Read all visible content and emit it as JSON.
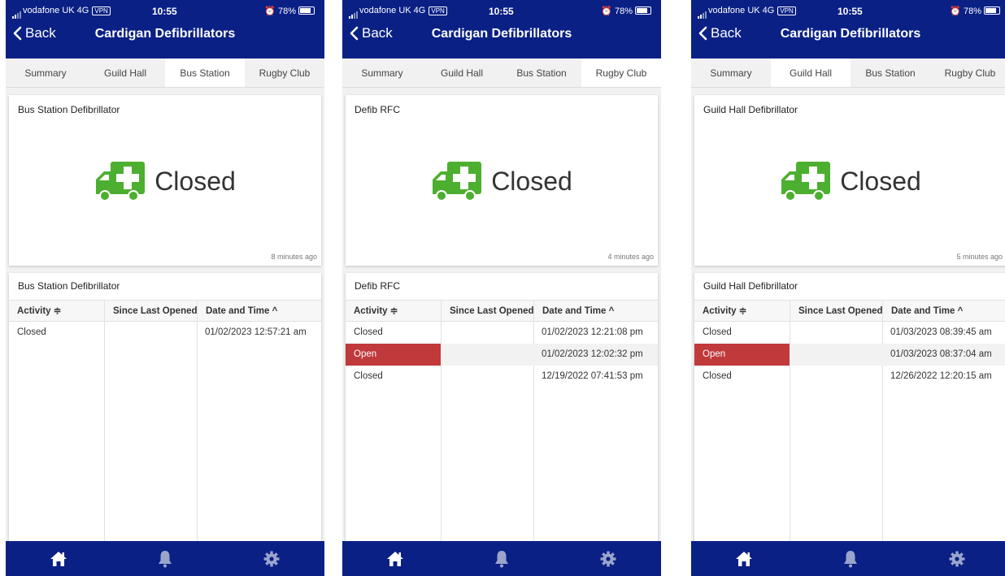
{
  "colors": {
    "header": "#0a2085",
    "ambulance": "#4caf2f",
    "open": "#c0393b"
  },
  "status_bar": {
    "carrier": "vodafone UK",
    "network": "4G",
    "vpn": "VPN",
    "time": "10:55",
    "battery": "78%"
  },
  "nav": {
    "back_label": "Back",
    "title": "Cardigan Defibrillators"
  },
  "tabs": [
    "Summary",
    "Guild Hall",
    "Bus Station",
    "Rugby Club"
  ],
  "table_headers": {
    "activity": "Activity ≑",
    "since": "Since Last Opened",
    "datetime": "Date and Time ^"
  },
  "footer_icons": [
    "home-icon",
    "bell-icon",
    "gear-icon"
  ],
  "screens": [
    {
      "active_tab": 2,
      "card_title": "Bus Station Defibrillator",
      "status": "Closed",
      "updated": "8 minutes ago",
      "table_title": "Bus Station Defibrillator",
      "rows": [
        {
          "activity": "Closed",
          "since": "",
          "datetime": "01/02/2023 12:57:21 am"
        }
      ]
    },
    {
      "active_tab": 3,
      "card_title": "Defib RFC",
      "status": "Closed",
      "updated": "4 minutes ago",
      "table_title": "Defib RFC",
      "rows": [
        {
          "activity": "Closed",
          "since": "",
          "datetime": "01/02/2023 12:21:08 pm"
        },
        {
          "activity": "Open",
          "since": "",
          "datetime": "01/02/2023 12:02:32 pm"
        },
        {
          "activity": "Closed",
          "since": "",
          "datetime": "12/19/2022 07:41:53 pm"
        }
      ]
    },
    {
      "active_tab": 1,
      "card_title": "Guild Hall Defibrillator",
      "status": "Closed",
      "updated": "5 minutes ago",
      "table_title": "Guild Hall Defibrillator",
      "rows": [
        {
          "activity": "Closed",
          "since": "",
          "datetime": "01/03/2023 08:39:45 am"
        },
        {
          "activity": "Open",
          "since": "",
          "datetime": "01/03/2023 08:37:04 am"
        },
        {
          "activity": "Closed",
          "since": "",
          "datetime": "12/26/2022 12:20:15 am"
        }
      ]
    }
  ]
}
